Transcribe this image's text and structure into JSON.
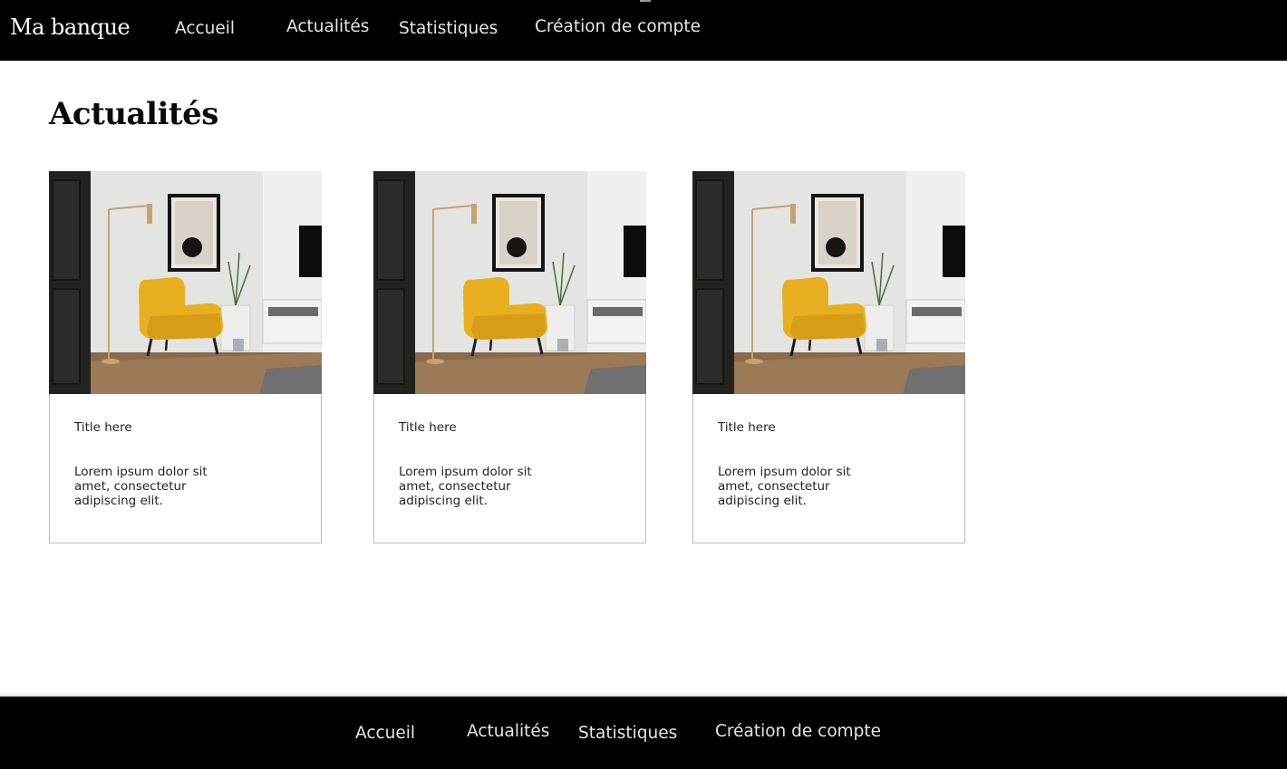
{
  "header": {
    "brand": "Ma banque",
    "nav": [
      "Accueil",
      "Actualités",
      "Statistiques",
      "Création de compte"
    ]
  },
  "main": {
    "title": "Actualités",
    "cards": [
      {
        "title": "Title here",
        "text": "Lorem ipsum dolor sit amet, consectetur adipiscing elit.",
        "image": "living-room-yellow-armchair-photo"
      },
      {
        "title": "Title here",
        "text": "Lorem ipsum dolor sit amet, consectetur adipiscing elit.",
        "image": "living-room-yellow-armchair-photo"
      },
      {
        "title": "Title here",
        "text": "Lorem ipsum dolor sit amet, consectetur adipiscing elit.",
        "image": "living-room-yellow-armchair-photo"
      }
    ]
  },
  "footer": {
    "nav": [
      "Accueil",
      "Actualités",
      "Statistiques",
      "Création de compte"
    ]
  },
  "colors": {
    "bar": "#000000",
    "page_background": "#ffffff",
    "armchair": "#e8b020"
  }
}
